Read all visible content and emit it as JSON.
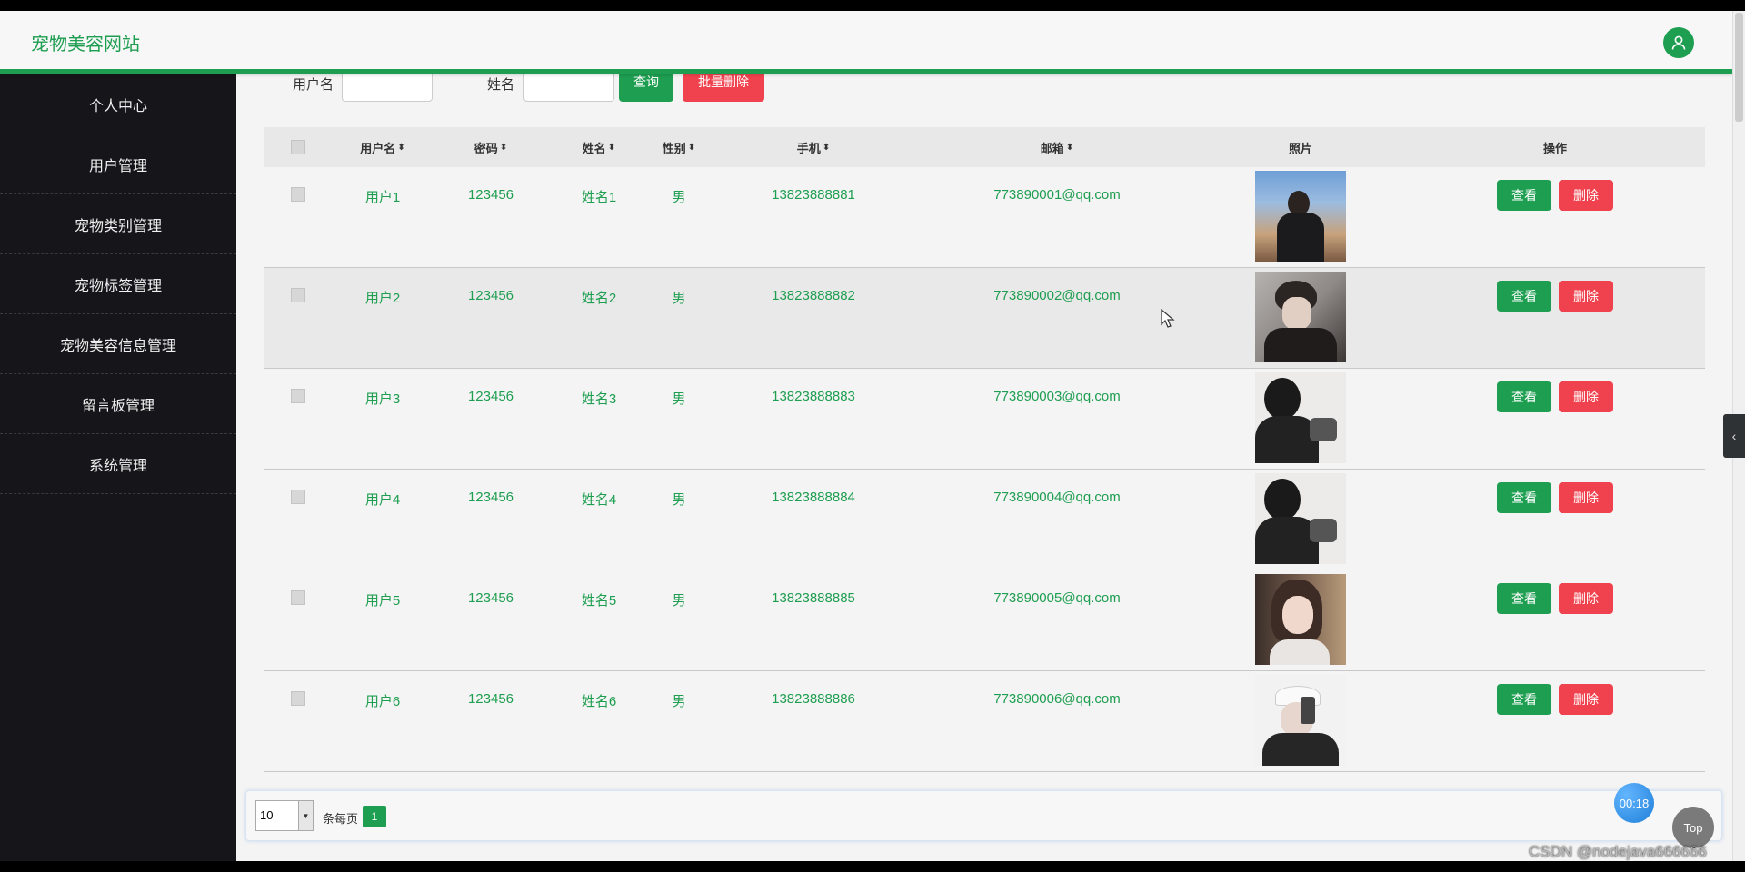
{
  "header": {
    "site_title": "宠物美容网站",
    "user_icon": "user-icon"
  },
  "sidebar": {
    "items": [
      {
        "label": "个人中心"
      },
      {
        "label": "用户管理"
      },
      {
        "label": "宠物类别管理"
      },
      {
        "label": "宠物标签管理"
      },
      {
        "label": "宠物美容信息管理"
      },
      {
        "label": "留言板管理"
      },
      {
        "label": "系统管理"
      }
    ]
  },
  "search": {
    "username_label": "用户名",
    "name_label": "姓名",
    "query_button": "查询",
    "batch_delete_button": "批量删除"
  },
  "table": {
    "headers": {
      "username": "用户名",
      "password": "密码",
      "name": "姓名",
      "gender": "性别",
      "phone": "手机",
      "email": "邮箱",
      "photo": "照片",
      "actions": "操作"
    },
    "sort_icon": "⬍",
    "rows": [
      {
        "username": "用户1",
        "password": "123456",
        "name": "姓名1",
        "gender": "男",
        "phone": "13823888881",
        "email": "773890001@qq.com",
        "view": "查看",
        "delete": "删除"
      },
      {
        "username": "用户2",
        "password": "123456",
        "name": "姓名2",
        "gender": "男",
        "phone": "13823888882",
        "email": "773890002@qq.com",
        "view": "查看",
        "delete": "删除"
      },
      {
        "username": "用户3",
        "password": "123456",
        "name": "姓名3",
        "gender": "男",
        "phone": "13823888883",
        "email": "773890003@qq.com",
        "view": "查看",
        "delete": "删除"
      },
      {
        "username": "用户4",
        "password": "123456",
        "name": "姓名4",
        "gender": "男",
        "phone": "13823888884",
        "email": "773890004@qq.com",
        "view": "查看",
        "delete": "删除"
      },
      {
        "username": "用户5",
        "password": "123456",
        "name": "姓名5",
        "gender": "男",
        "phone": "13823888885",
        "email": "773890005@qq.com",
        "view": "查看",
        "delete": "删除"
      },
      {
        "username": "用户6",
        "password": "123456",
        "name": "姓名6",
        "gender": "男",
        "phone": "13823888886",
        "email": "773890006@qq.com",
        "view": "查看",
        "delete": "删除"
      }
    ]
  },
  "pagination": {
    "page_size": "10",
    "per_page_label": "条每页",
    "current_page": "1"
  },
  "overlay": {
    "timer": "00:18",
    "top_button": "Top",
    "watermark": "CSDN @nodejava666666"
  },
  "colors": {
    "accent": "#1e9e50",
    "danger": "#f0424e",
    "sidebar_bg": "#16161a"
  }
}
